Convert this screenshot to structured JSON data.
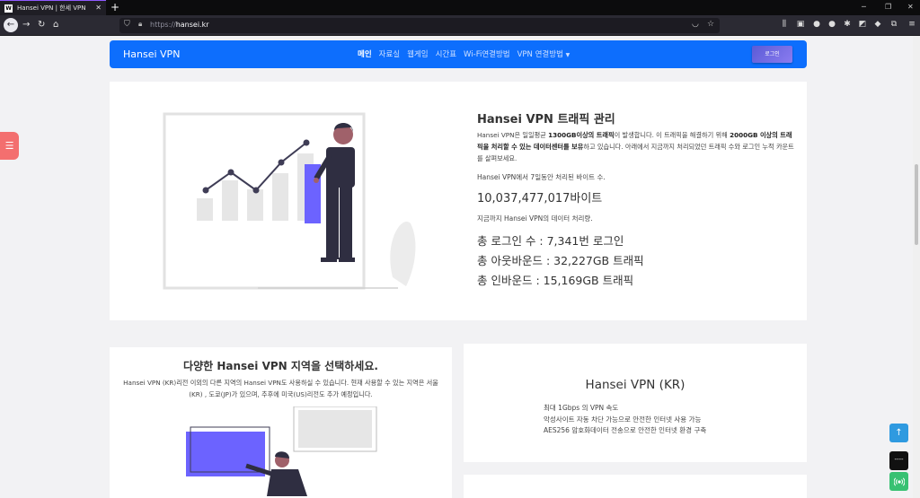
{
  "browser": {
    "tab_title": "Hansei VPN | 한세 VPN",
    "tab_favicon": "W",
    "url_prefix": "https://",
    "url_host": "hansei.kr"
  },
  "site": {
    "brand": "Hansei VPN",
    "menu": [
      "메인",
      "자료실",
      "웹게임",
      "시간표",
      "Wi-Fi연결방법",
      "VPN 연결방법"
    ],
    "login": "로그인",
    "accent": "#0d6efd"
  },
  "hero": {
    "title": "Hansei VPN 트래픽 관리",
    "desc_1": "Hansei VPN은 일일평균 ",
    "desc_b1": "1300GB이상의 트래픽",
    "desc_2": "이 발생합니다. 이 트래픽을 해결하기 위해 ",
    "desc_b2": "2000GB 이상의 트래픽을 처리할 수 있는 데이터센터를 보유",
    "desc_3": "하고 있습니다. 아래에서 지금까지 처리되었던 트래픽 수와 로그인 누적 카운트를 살펴보세요.",
    "sub1": "Hansei VPN에서 7일동안 처리된 바이트 수.",
    "bytes": "10,037,477,017바이트",
    "sub2": "지금까지 Hansei VPN의 데이터 처리량.",
    "login_count": "총 로그인 수 : 7,341번 로그인",
    "outbound": "총 아웃바운드 : 32,227GB 트래픽",
    "inbound": "총 인바운드 : 15,169GB 트래픽"
  },
  "region": {
    "title": "다양한 Hansei VPN 지역을 선택하세요.",
    "desc": "Hansei VPN (KR)리전 이외의 다른 지역의 Hansei VPN도 사용하실 수 있습니다. 현재 사용할 수 있는 지역은 서울(KR) , 도쿄(JP)가 있으며, 추후에 미국(US)리전도 추가 예정입니다."
  },
  "kr": {
    "title": "Hansei VPN (KR)",
    "features": [
      "최대 1Gbps 의 VPN 속도",
      "악성사이트 자동 차단 가능으로 안전한 인터넷 사용 가능",
      "AES256 암호화데이터 전송으로 안전한 인터넷 환경 구축"
    ]
  },
  "fabs": {
    "up": "↑",
    "dark": "----",
    "chat": "☰",
    "signal": "((•))"
  }
}
